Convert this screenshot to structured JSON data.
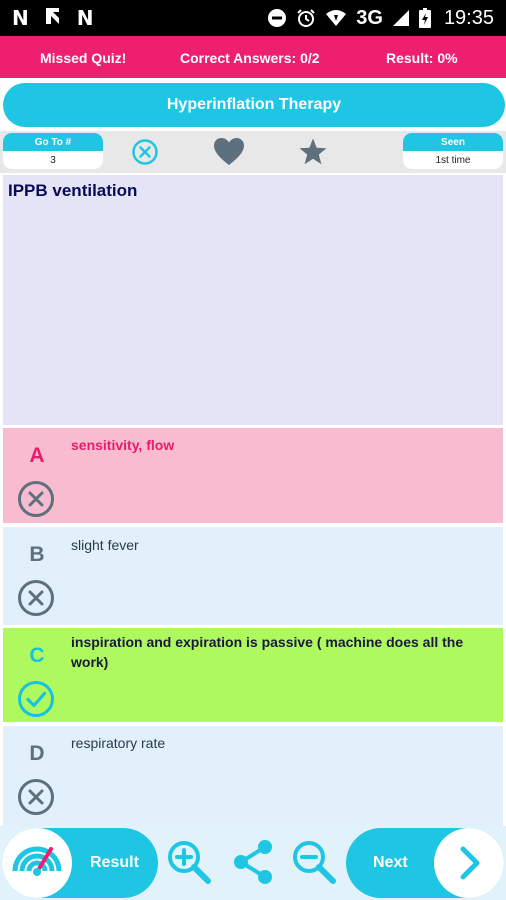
{
  "status_bar": {
    "left_glyphs": [
      "N",
      "⫫",
      "N"
    ],
    "network": "3G",
    "time": "19:35"
  },
  "info_bar": {
    "missed": "Missed Quiz!",
    "correct": "Correct Answers: 0/2",
    "result": "Result: 0%"
  },
  "title": "Hyperinflation Therapy",
  "toolbar": {
    "goto_label": "Go To #",
    "goto_value": "3",
    "seen_label": "Seen",
    "seen_value": "1st time",
    "icons": [
      "close-circle-icon",
      "heart-icon",
      "star-icon"
    ]
  },
  "question": "IPPB ventilation",
  "answers": [
    {
      "letter": "A",
      "text": "sensitivity, flow",
      "state": "wrong-selected",
      "mark": "cross-circle-icon"
    },
    {
      "letter": "B",
      "text": "slight fever",
      "state": "neutral",
      "mark": "cross-circle-icon"
    },
    {
      "letter": "C",
      "text": "inspiration and expiration is passive ( machine does all the work)",
      "state": "correct",
      "mark": "check-circle-icon"
    },
    {
      "letter": "D",
      "text": "respiratory rate",
      "state": "neutral",
      "mark": "cross-circle-icon"
    }
  ],
  "bottom_bar": {
    "result_label": "Result",
    "next_label": "Next",
    "icons": [
      "result-gauge-icon",
      "zoom-in-icon",
      "share-icon",
      "zoom-out-icon",
      "chevron-right-icon"
    ]
  },
  "colors": {
    "accent_pink": "#ef1f70",
    "accent_cyan": "#1fc6e4",
    "correct_green": "#aef95e",
    "wrong_pink": "#f7bccf",
    "neutral_blue": "#e1f0fb",
    "question_bg": "#e4e4f6"
  }
}
